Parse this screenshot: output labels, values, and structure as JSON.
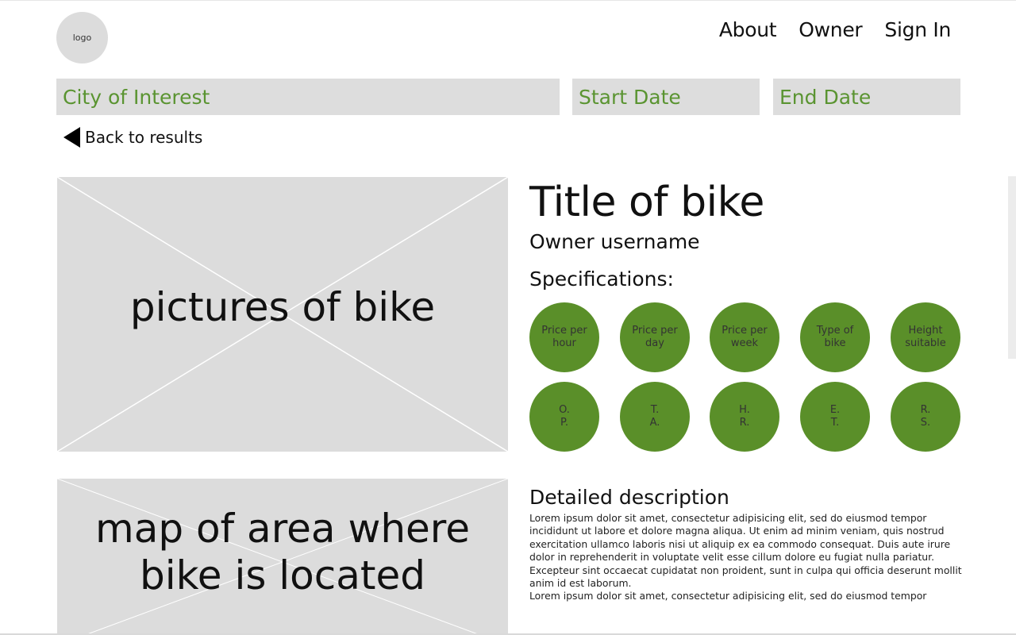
{
  "header": {
    "logo_text": "logo",
    "nav": [
      "About",
      "Owner",
      "Sign In"
    ]
  },
  "search": {
    "city_placeholder": "City of Interest",
    "start_placeholder": "Start Date",
    "end_placeholder": "End Date"
  },
  "back_label": "Back to results",
  "pictures_placeholder": "pictures of bike",
  "map_placeholder": "map of area where bike is located",
  "bike": {
    "title": "Title of bike",
    "owner": "Owner username",
    "specs_heading": "Specifications:",
    "specs_row1": [
      "Price per hour",
      "Price per day",
      "Price per week",
      "Type of bike",
      "Height suitable"
    ],
    "specs_row2": [
      "O. P.",
      "T. A.",
      "H. R.",
      "E. T.",
      "R. S."
    ]
  },
  "description": {
    "heading": "Detailed description",
    "paragraph1": "Lorem ipsum dolor sit amet, consectetur adipisicing elit, sed do eiusmod tempor incididunt ut labore et dolore magna aliqua. Ut enim ad minim veniam, quis nostrud exercitation ullamco laboris nisi ut aliquip ex ea commodo consequat. Duis aute irure dolor in reprehenderit in voluptate velit esse cillum dolore eu fugiat nulla pariatur. Excepteur sint occaecat cupidatat non proident, sunt in culpa qui officia deserunt mollit anim id est laborum.",
    "paragraph2": "Lorem ipsum dolor sit amet, consectetur adipisicing elit, sed do eiusmod tempor"
  },
  "colors": {
    "accent_green": "#5a8f29",
    "placeholder_text_green": "#5a9431",
    "placeholder_gray": "#dcdcdc"
  },
  "icons": {
    "back": "triangle-left-icon"
  }
}
